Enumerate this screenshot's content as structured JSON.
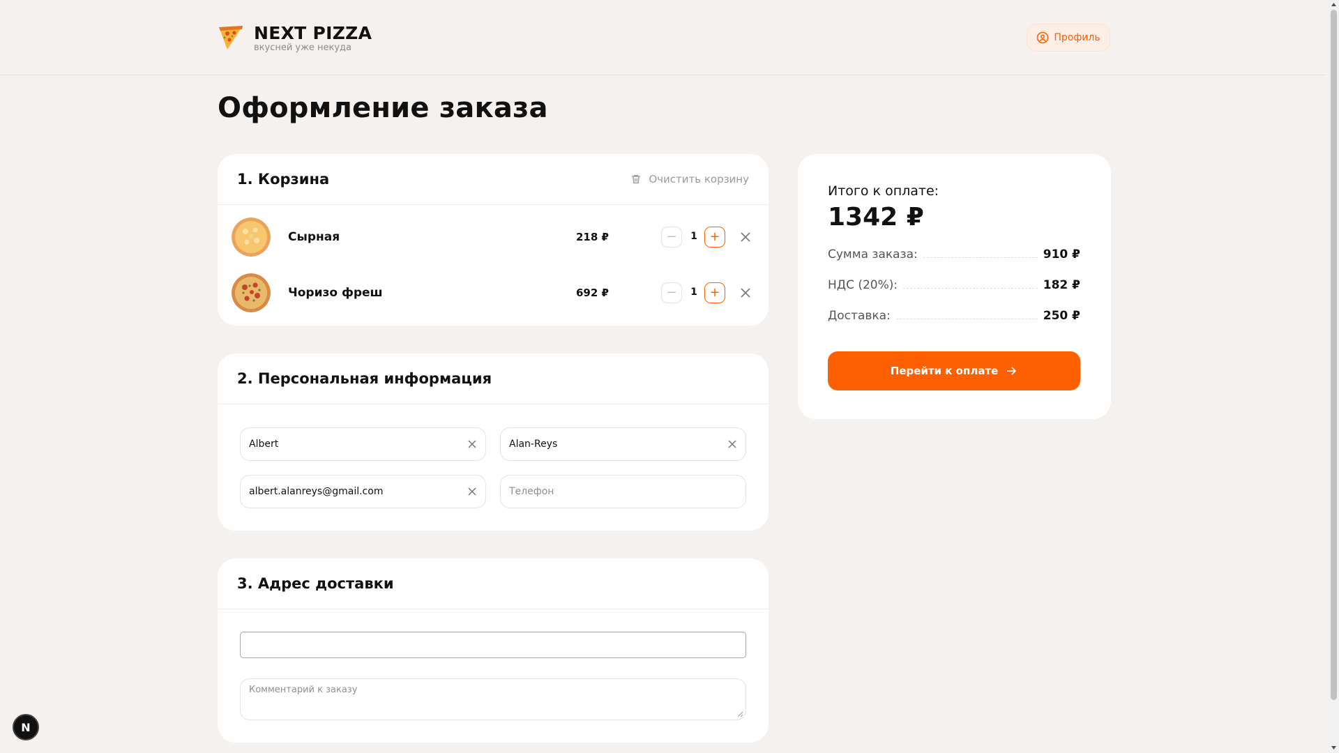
{
  "header": {
    "logo_title": "NEXT PIZZA",
    "logo_subtitle": "вкусней уже некуда",
    "profile_label": "Профиль"
  },
  "page_title": "Оформление заказа",
  "cart": {
    "title": "1. Корзина",
    "clear_label": "Очистить корзину",
    "items": [
      {
        "name": "Сырная",
        "price": "218 ₽",
        "quantity": "1"
      },
      {
        "name": "Чоризо фреш",
        "price": "692 ₽",
        "quantity": "1"
      }
    ]
  },
  "personal": {
    "title": "2. Персональная информация",
    "first_name": "Albert",
    "last_name": "Alan-Reys",
    "email": "albert.alanreys@gmail.com",
    "phone_placeholder": "Телефон"
  },
  "address": {
    "title": "3. Адрес доставки",
    "address_value": "",
    "comment_placeholder": "Комментарий к заказу"
  },
  "summary": {
    "total_label": "Итого к оплате:",
    "total_value": "1342 ₽",
    "rows": [
      {
        "label": "Сумма заказа:",
        "value": "910 ₽"
      },
      {
        "label": "НДС (20%):",
        "value": "182 ₽"
      },
      {
        "label": "Доставка:",
        "value": "250 ₽"
      }
    ],
    "pay_label": "Перейти к оплате"
  },
  "next_badge": "N",
  "colors": {
    "accent": "#fe5f00",
    "background": "#f4f1ee",
    "card": "#ffffff"
  }
}
